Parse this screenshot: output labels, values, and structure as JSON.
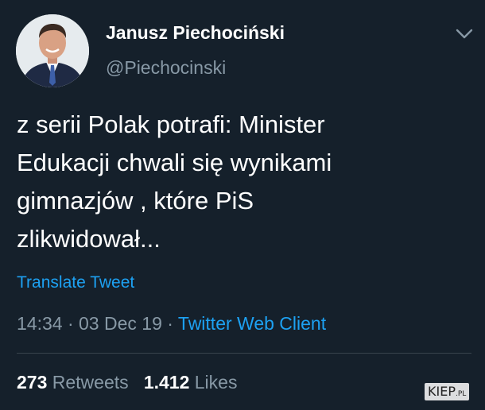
{
  "tweet": {
    "author": {
      "name": "Janusz Piechociński",
      "handle": "@Piechocinski"
    },
    "text_lines": [
      "z serii Polak potrafi: Minister",
      "Edukacji chwali się wynikami",
      "gimnazjów , które PiS",
      "zlikwidował..."
    ],
    "translate_label": "Translate Tweet",
    "time": "14:34",
    "date": "03 Dec 19",
    "separator": "·",
    "client": "Twitter Web Client",
    "stats": {
      "retweets_count": "273",
      "retweets_label": "Retweets",
      "likes_count": "1.412",
      "likes_label": "Likes"
    }
  },
  "watermark": {
    "main": "KIEP",
    "suffix": ".PL"
  },
  "icons": {
    "menu": "chevron-down-icon",
    "avatar": "avatar"
  },
  "colors": {
    "background": "#15202b",
    "text": "#ffffff",
    "secondary_text": "#8899a6",
    "accent": "#1da1f2",
    "divider": "#38444d"
  }
}
